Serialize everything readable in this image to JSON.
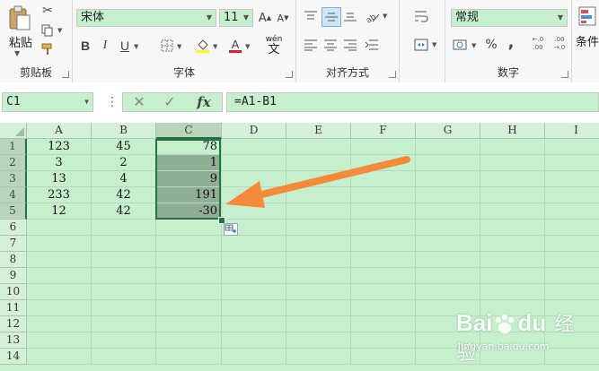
{
  "ribbon": {
    "clipboard": {
      "paste_label": "粘贴",
      "group_label": "剪贴板"
    },
    "font": {
      "font_name": "宋体",
      "font_size": "11",
      "bold": "B",
      "italic": "I",
      "underline": "U",
      "font_color_letter": "A",
      "wen_label": "wén",
      "wen_char": "文",
      "grow_font": "A",
      "shrink_font": "A",
      "group_label": "字体"
    },
    "alignment": {
      "group_label": "对齐方式"
    },
    "number": {
      "format": "常规",
      "percent": "%",
      "comma": ",",
      "inc_decimal": "←.0 .00",
      "dec_decimal": ".00 →.0",
      "group_label": "数字"
    },
    "styles": {
      "conditional_label": "条件"
    }
  },
  "formula_bar": {
    "name_box": "C1",
    "fx": "fx",
    "formula": "=A1-B1"
  },
  "sheet": {
    "columns": [
      "A",
      "B",
      "C",
      "D",
      "E",
      "F",
      "G",
      "H",
      "I"
    ],
    "rows": [
      "1",
      "2",
      "3",
      "4",
      "5",
      "6",
      "7",
      "8",
      "9",
      "10",
      "11",
      "12",
      "13",
      "14"
    ],
    "data": [
      [
        "123",
        "45",
        "78"
      ],
      [
        "3",
        "2",
        "1"
      ],
      [
        "13",
        "4",
        "9"
      ],
      [
        "233",
        "42",
        "191"
      ],
      [
        "12",
        "42",
        "-30"
      ]
    ]
  },
  "colors": {
    "sheet_bg": "#c6efce",
    "selection_border": "#217346",
    "arrow": "#f58a3a"
  },
  "watermark": {
    "brand": "Bai",
    "brand2": "du",
    "cn": "经验",
    "url": "jingyan.baidu.com"
  }
}
